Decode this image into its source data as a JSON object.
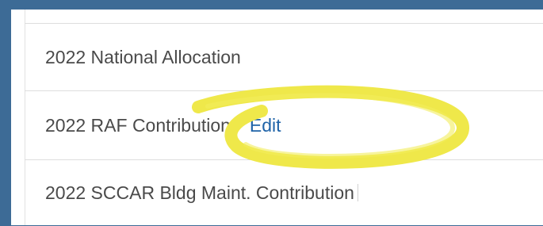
{
  "contribution_list": {
    "rows": [
      {
        "label": "2022 National Allocation"
      },
      {
        "label": "2022 RAF Contribution**",
        "link_label": "Edit"
      },
      {
        "label": "2022 SCCAR Bldg Maint. Contribution"
      }
    ]
  },
  "colors": {
    "page_background": "#3d6b96",
    "link": "#1f63a8",
    "highlight": "#efe84a"
  }
}
